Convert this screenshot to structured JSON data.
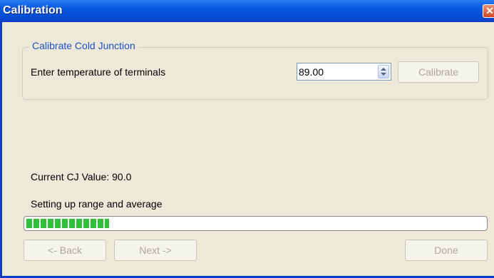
{
  "window": {
    "title": "Calibration",
    "close_icon": "close-icon"
  },
  "group": {
    "legend": "Calibrate Cold Junction",
    "prompt": "Enter temperature of terminals",
    "temperature_value": "89.00",
    "calibrate_label": "Calibrate"
  },
  "status": {
    "current_cj_text": "Current CJ Value: 90.0",
    "progress_text": "Setting up range and average",
    "progress_fraction": 0.18
  },
  "footer": {
    "back_label": "<- Back",
    "next_label": "Next ->",
    "done_label": "Done"
  },
  "colors": {
    "titlebar": "#0a5ae0",
    "window_bg": "#ece9d8",
    "legend_text": "#1f4fc8",
    "progress_fill": "#2fbf38",
    "disabled_text": "#aca899"
  }
}
